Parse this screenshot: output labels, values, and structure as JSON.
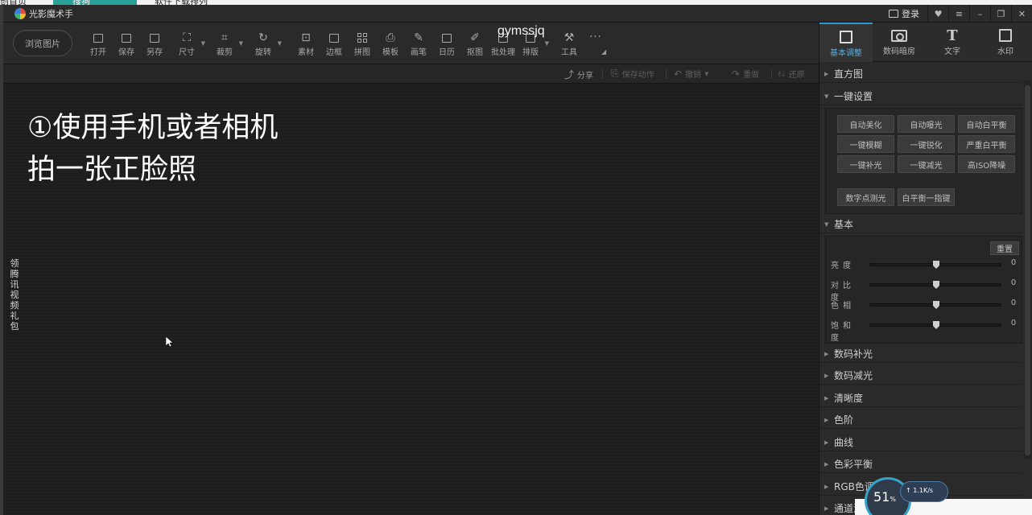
{
  "browser_tabs": [
    {
      "label": "创首页",
      "active": false
    },
    {
      "label": "搜狗",
      "active": true
    },
    {
      "label": "软件下载排列",
      "active": false
    }
  ],
  "app": {
    "title": "光影魔术手",
    "login_label": "登录"
  },
  "toolbar": {
    "browse_label": "浏览图片",
    "tools": [
      {
        "label": "打开",
        "icon": "open-icon"
      },
      {
        "label": "保存",
        "icon": "save-icon"
      },
      {
        "label": "另存",
        "icon": "save-as-icon"
      },
      {
        "label": "尺寸",
        "icon": "resize-icon"
      },
      {
        "label": "裁剪",
        "icon": "crop-icon"
      },
      {
        "label": "旋转",
        "icon": "rotate-icon"
      },
      {
        "label": "素材",
        "icon": "material-icon"
      },
      {
        "label": "边框",
        "icon": "border-icon"
      },
      {
        "label": "拼图",
        "icon": "collage-icon"
      },
      {
        "label": "模板",
        "icon": "template-icon"
      },
      {
        "label": "画笔",
        "icon": "brush-icon"
      },
      {
        "label": "日历",
        "icon": "calendar-icon"
      },
      {
        "label": "抠图",
        "icon": "cutout-icon"
      },
      {
        "label": "批处理",
        "icon": "batch-icon"
      },
      {
        "label": "排版",
        "icon": "layout-icon"
      },
      {
        "label": "工具",
        "icon": "tools-icon"
      }
    ]
  },
  "overlay_text": "gymssjq",
  "actions": {
    "share": "分享",
    "save_action": "保存动作",
    "undo": "撤销",
    "redo": "重做",
    "restore": "还原"
  },
  "canvas": {
    "line1": "①使用手机或者相机",
    "line2": "拍一张正脸照",
    "side_tab": "领腾讯视频礼包"
  },
  "right_panel": {
    "tabs": [
      {
        "label": "基本调整",
        "icon": "edit-icon",
        "active": true
      },
      {
        "label": "数码暗房",
        "icon": "camera-icon",
        "active": false
      },
      {
        "label": "文字",
        "icon": "text-icon",
        "active": false
      },
      {
        "label": "水印",
        "icon": "watermark-icon",
        "active": false
      }
    ],
    "sections": {
      "histogram": "直方图",
      "one_click": "一键设置",
      "basic": "基本",
      "digital_fill": "数码补光",
      "digital_reduce": "数码减光",
      "sharpness": "清晰度",
      "levels": "色阶",
      "curves": "曲线",
      "color_balance": "色彩平衡",
      "rgb": "RGB色调",
      "channel": "通道混"
    },
    "one_click_buttons": [
      "自动美化",
      "自动曝光",
      "自动白平衡",
      "一键模糊",
      "一键锐化",
      "严重白平衡",
      "一键补光",
      "一键减光",
      "高ISO降噪",
      "数字点测光",
      "白平衡一指键"
    ],
    "reset_label": "重置",
    "sliders": [
      {
        "label": "亮度",
        "value": "0"
      },
      {
        "label": "对比度",
        "value": "0"
      },
      {
        "label": "色相",
        "value": "0"
      },
      {
        "label": "饱和度",
        "value": "0"
      }
    ]
  },
  "widget": {
    "percent": "51",
    "speed": "1.1K/s"
  },
  "colors": {
    "accent": "#2b9bd6",
    "panel_bg": "#2a2a2a",
    "canvas_bg": "#1d1d1d"
  }
}
